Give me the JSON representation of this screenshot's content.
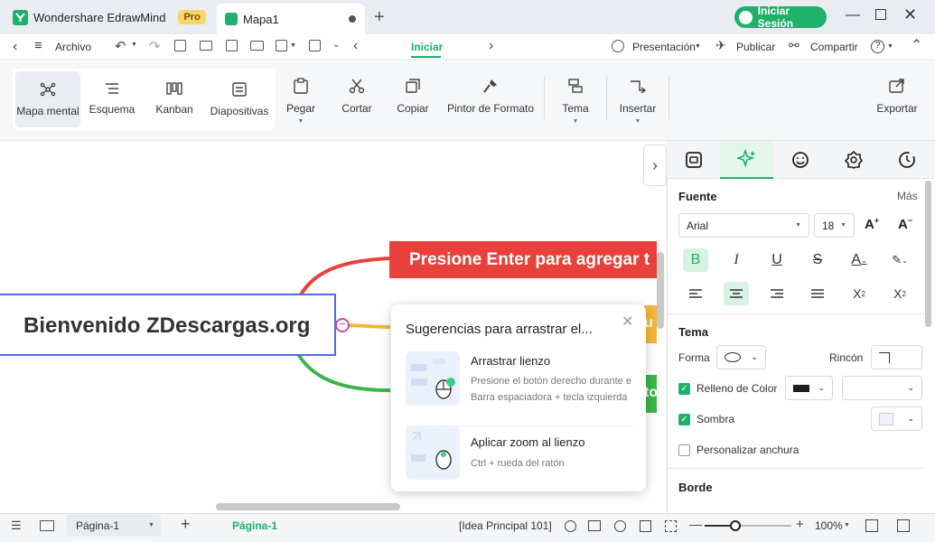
{
  "app": {
    "name": "Wondershare EdrawMind",
    "badge": "Pro",
    "doc_tab": "Mapa1",
    "login": "Iniciar Sesión"
  },
  "menu": {
    "file": "Archivo",
    "active_tab": "Iniciar",
    "presentation": "Presentación",
    "publish": "Publicar",
    "share": "Compartir"
  },
  "ribbon": {
    "views": [
      "Mapa mental",
      "Esquema",
      "Kanban",
      "Diapositivas"
    ],
    "tools": [
      "Pegar",
      "Cortar",
      "Copiar",
      "Pintor de Formato",
      "Tema",
      "Insertar",
      "Exportar"
    ]
  },
  "canvas": {
    "central_topic": "Bienvenido ZDescargas.org",
    "topic_red": "Presione Enter para agregar t",
    "topic_yellow_fragment": "u",
    "topic_green_fragment": "to"
  },
  "popup": {
    "title": "Sugerencias para arrastrar el...",
    "items": [
      {
        "title": "Arrastrar lienzo",
        "line1": "Presione el botón derecho durante e",
        "line2": "Barra espaciadora + tecla izquierda"
      },
      {
        "title": "Aplicar zoom al lienzo",
        "line1": "Ctrl + rueda del ratón"
      }
    ]
  },
  "panel": {
    "font_section": "Fuente",
    "more": "Más",
    "font_family": "Arial",
    "font_size": "18",
    "theme_section": "Tema",
    "shape_label": "Forma",
    "corner_label": "Rincón",
    "fill_label": "Relleno de Color",
    "shadow_label": "Sombra",
    "width_label": "Personalizar anchura",
    "border_section": "Borde",
    "fill_checked": true,
    "shadow_checked": true,
    "width_checked": false,
    "fill_color": "#1f1f1f"
  },
  "status": {
    "page_select": "Página-1",
    "page_tab": "Página-1",
    "idea": "[Idea Principal 101]",
    "zoom": "100%",
    "zoom_level": 0.35
  }
}
